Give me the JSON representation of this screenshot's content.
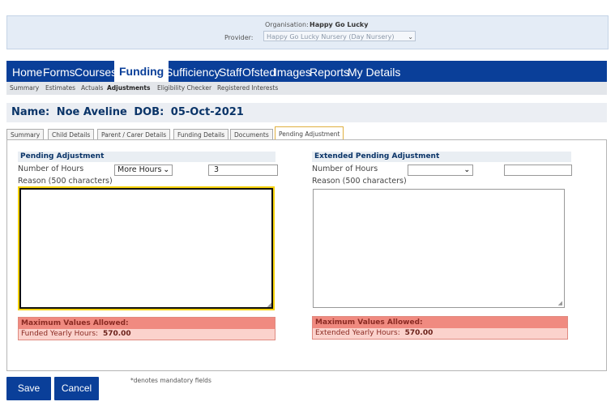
{
  "organisation": {
    "org_label": "Organisation:",
    "org_value": "Happy Go Lucky",
    "provider_label": "Provider:",
    "provider_value": "Happy Go Lucky Nursery (Day Nursery)"
  },
  "main_nav": [
    "Home",
    "Forms",
    "Courses",
    "Funding",
    "Sufficiency",
    "Staff",
    "Ofsted",
    "Images",
    "Reports",
    "My Details"
  ],
  "sub_nav": [
    "Summary",
    "Estimates",
    "Actuals",
    "Adjustments",
    "Eligibility Checker",
    "Registered Interests"
  ],
  "child": {
    "name_label": "Name:",
    "name_value": "Noe Aveline",
    "dob_label": "DOB:",
    "dob_value": "05-Oct-2021"
  },
  "tabs": [
    "Summary",
    "Child Details",
    "Parent / Carer Details",
    "Funding Details",
    "Documents",
    "Pending Adjustment"
  ],
  "pending": {
    "title": "Pending Adjustment",
    "hours_label": "Number of Hours",
    "hours_select": "More Hours",
    "hours_value": "3",
    "reason_label": "Reason (500 characters)",
    "reason_value": "",
    "max_title": "Maximum Values Allowed:",
    "max_label": "Funded Yearly Hours:",
    "max_value": "570.00"
  },
  "extended": {
    "title": "Extended Pending Adjustment",
    "hours_label": "Number of Hours",
    "hours_select": "",
    "hours_value": "",
    "reason_label": "Reason (500 characters)",
    "reason_value": "",
    "max_title": "Maximum Values Allowed:",
    "max_label": "Extended Yearly Hours:",
    "max_value": "570.00"
  },
  "footer": {
    "save": "Save",
    "cancel": "Cancel",
    "mandatory_note": "*denotes mandatory fields"
  },
  "colors": {
    "nav_bg": "#0a3f99",
    "max_header": "#f08a80",
    "max_body": "#fbd2cc",
    "focus_border": "#f5d000"
  },
  "icons": [
    "chevron-down-icon",
    "resize-grip-icon"
  ]
}
